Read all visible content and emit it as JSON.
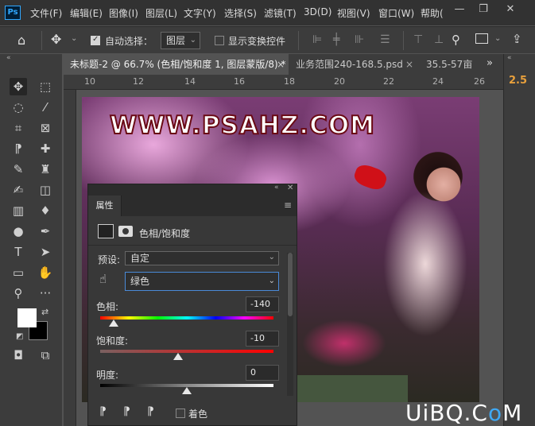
{
  "app": {
    "logo": "Ps"
  },
  "menu": [
    "文件(F)",
    "编辑(E)",
    "图像(I)",
    "图层(L)",
    "文字(Y)",
    "选择(S)",
    "滤镜(T)",
    "3D(D)",
    "视图(V)",
    "窗口(W)",
    "帮助("
  ],
  "window_controls": {
    "minimize": "—",
    "restore": "❐",
    "close": "✕"
  },
  "options": {
    "auto_select_label": "自动选择：",
    "auto_select_checked": true,
    "layer_dropdown": "图层",
    "show_transform_label": "显示变换控件",
    "show_transform_checked": false
  },
  "tabs": [
    {
      "label": "未标题-2 @ 66.7% (色相/饱和度 1, 图层蒙版/8) *",
      "active": true,
      "close": "×"
    },
    {
      "label": "业务范围240-168.5.psd",
      "active": false,
      "close": "×"
    },
    {
      "label": "35.5-57亩",
      "active": false
    }
  ],
  "tab_overflow": "»",
  "right_dock": {
    "value": "2.5"
  },
  "ruler_h": [
    "10",
    "12",
    "14",
    "16",
    "18",
    "20",
    "22",
    "24",
    "26"
  ],
  "canvas": {
    "watermark": "WWW.PSAHZ.COM"
  },
  "properties": {
    "panel_tab": "属性",
    "adjustment_name": "色相/饱和度",
    "preset_label": "预设:",
    "preset_value": "自定",
    "channel_value": "绿色",
    "hue_label": "色相:",
    "hue_value": "-140",
    "saturation_label": "饱和度:",
    "saturation_value": "-10",
    "lightness_label": "明度:",
    "lightness_value": "0",
    "colorize_label": "着色",
    "colorize_checked": false
  },
  "bottom_watermark": {
    "part1": "UiBQ.C",
    "part2": "o",
    "part3": "M"
  }
}
